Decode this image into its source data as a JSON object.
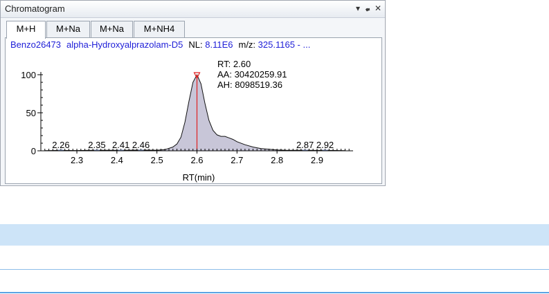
{
  "window": {
    "title": "Chromatogram",
    "controls": {
      "dropdown": "▾",
      "pin": "ᵖ",
      "close": "✕"
    }
  },
  "tabs": [
    {
      "label": "M+H",
      "active": true
    },
    {
      "label": "M+Na",
      "active": false
    },
    {
      "label": "M+Na",
      "active": false
    },
    {
      "label": "M+NH4",
      "active": false
    }
  ],
  "header": {
    "sample": "Benzo26473",
    "compound": "alpha-Hydroxyalprazolam-D5",
    "nl_label": "NL:",
    "nl_value": "8.11E6",
    "mz_label": "m/z:",
    "mz_value": "325.1165 - ..."
  },
  "annotation": {
    "rt": "RT: 2.60",
    "aa": "AA: 30420259.91",
    "ah": "AH: 8098519.36"
  },
  "chart_data": {
    "type": "line",
    "xlabel": "RT(min)",
    "ylabel": "",
    "xlim": [
      2.21,
      2.99
    ],
    "ylim": [
      0,
      100
    ],
    "x_ticks": [
      "2.3",
      "2.4",
      "2.5",
      "2.6",
      "2.7",
      "2.8",
      "2.9"
    ],
    "y_ticks": [
      "0",
      "50",
      "100"
    ],
    "series": [
      {
        "x": [
          2.22,
          2.26,
          2.3,
          2.35,
          2.41,
          2.46,
          2.5,
          2.52,
          2.54,
          2.55,
          2.56,
          2.57,
          2.58,
          2.59,
          2.6,
          2.61,
          2.62,
          2.63,
          2.64,
          2.65,
          2.66,
          2.67,
          2.68,
          2.69,
          2.7,
          2.72,
          2.74,
          2.76,
          2.78,
          2.8,
          2.82,
          2.85,
          2.87,
          2.9,
          2.92,
          2.97
        ],
        "y": [
          0.3,
          0.5,
          0.4,
          0.8,
          0.6,
          1.0,
          0.8,
          1.5,
          5,
          9,
          18,
          38,
          65,
          90,
          100,
          88,
          62,
          40,
          27,
          21,
          19,
          19,
          17,
          15,
          12,
          8,
          5,
          3,
          2,
          1.2,
          0.8,
          0.6,
          0.8,
          0.5,
          0.6,
          0.3
        ]
      }
    ],
    "peak_labels": [
      {
        "x": 2.26,
        "label": "2.26"
      },
      {
        "x": 2.35,
        "label": "2.35"
      },
      {
        "x": 2.41,
        "label": "2.41"
      },
      {
        "x": 2.46,
        "label": "2.46"
      },
      {
        "x": 2.87,
        "label": "2.87"
      },
      {
        "x": 2.92,
        "label": "2.92"
      }
    ],
    "marker_rt": 2.6,
    "colors": {
      "fill": "#c8c6d8",
      "line": "#111111",
      "marker": "#e02020",
      "axis": "#000000"
    }
  }
}
